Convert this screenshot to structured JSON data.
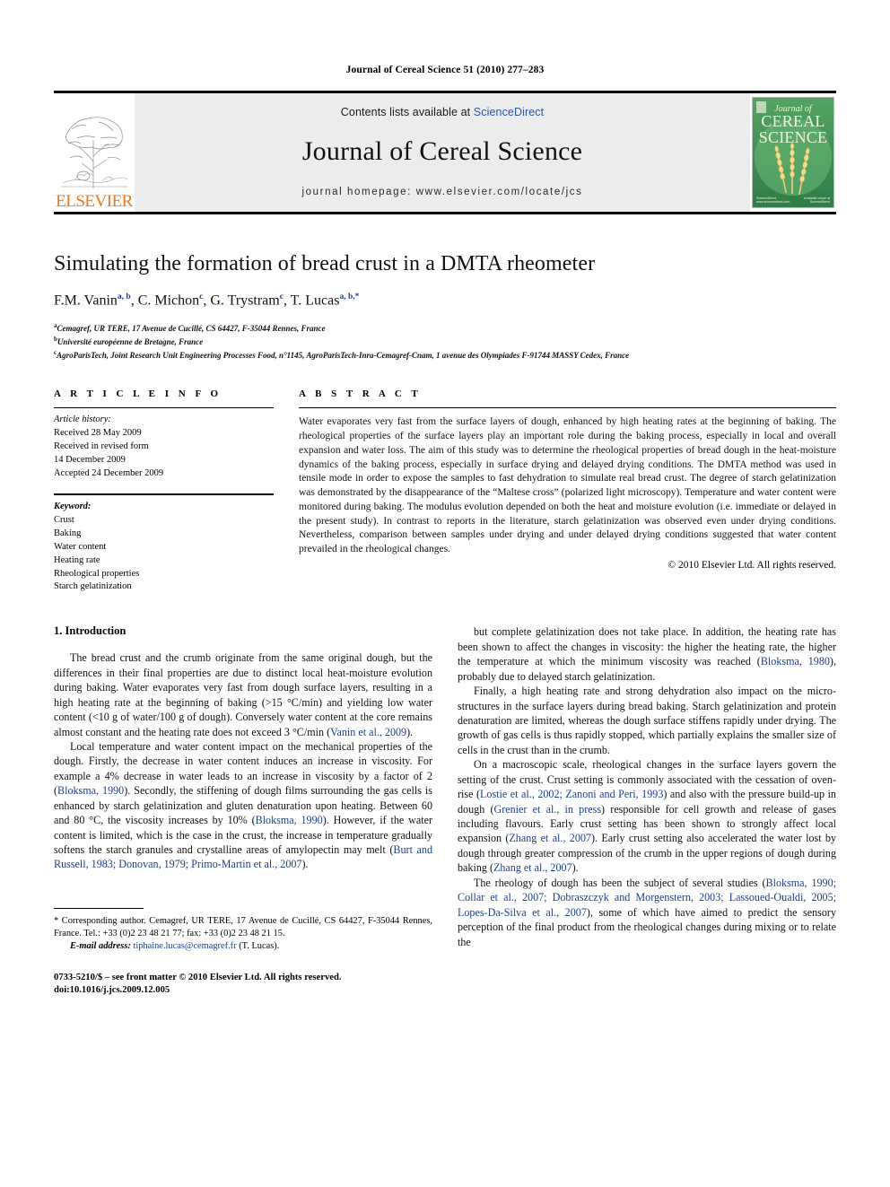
{
  "running_head": "Journal of Cereal Science 51 (2010) 277–283",
  "masthead": {
    "publisher_name": "ELSEVIER",
    "contents_prefix": "Contents lists available at ",
    "contents_link": "ScienceDirect",
    "journal_name": "Journal of Cereal Science",
    "homepage": "journal homepage: www.elsevier.com/locate/jcs",
    "cover": {
      "line1": "Journal of",
      "line2": "CEREAL",
      "line3": "SCIENCE",
      "foot_left": "ScienceDirect\nwww.sciencedirect.com",
      "foot_right": "Available online at\nScienceDirect"
    },
    "link_color": "#2b55a8",
    "band_color": "#ececec",
    "elsevier_orange": "#E87722"
  },
  "article": {
    "title": "Simulating the formation of bread crust in a DMTA rheometer",
    "authors": [
      {
        "name": "F.M. Vanin",
        "sup": "a, b"
      },
      {
        "name": "C. Michon",
        "sup": "c"
      },
      {
        "name": "G. Trystram",
        "sup": "c"
      },
      {
        "name": "T. Lucas",
        "sup": "a, b,*"
      }
    ],
    "affiliations": [
      {
        "mark": "a",
        "text": "Cemagref, UR TERE, 17 Avenue de Cucillé, CS 64427, F-35044 Rennes, France"
      },
      {
        "mark": "b",
        "text": "Université européenne de Bretagne, France"
      },
      {
        "mark": "c",
        "text": "AgroParisTech, Joint Research Unit Engineering Processes Food, n°1145, AgroParisTech-Inra-Cemagref-Cnam, 1 avenue des Olympiades F-91744 MASSY Cedex, France"
      }
    ]
  },
  "article_info": {
    "heading": "A R T I C L E   I N F O",
    "history_label": "Article history:",
    "history_lines": [
      "Received 28 May 2009",
      "Received in revised form",
      "14 December 2009",
      "Accepted 24 December 2009"
    ],
    "keywords_label": "Keyword:",
    "keywords": [
      "Crust",
      "Baking",
      "Water content",
      "Heating rate",
      "Rheological properties",
      "Starch gelatinization"
    ]
  },
  "abstract": {
    "heading": "A B S T R A C T",
    "text": "Water evaporates very fast from the surface layers of dough, enhanced by high heating rates at the beginning of baking. The rheological properties of the surface layers play an important role during the baking process, especially in local and overall expansion and water loss. The aim of this study was to determine the rheological properties of bread dough in the heat-moisture dynamics of the baking process, especially in surface drying and delayed drying conditions. The DMTA method was used in tensile mode in order to expose the samples to fast dehydration to simulate real bread crust. The degree of starch gelatinization was demonstrated by the disappearance of the “Maltese cross” (polarized light microscopy). Temperature and water content were monitored during baking. The modulus evolution depended on both the heat and moisture evolution (i.e. immediate or delayed in the present study). In contrast to reports in the literature, starch gelatinization was observed even under drying conditions. Nevertheless, comparison between samples under drying and under delayed drying conditions suggested that water content prevailed in the rheological changes.",
    "copyright": "© 2010 Elsevier Ltd. All rights reserved."
  },
  "body": {
    "section_number_title": "1. Introduction",
    "left_paragraphs": [
      {
        "segments": [
          {
            "t": "The bread crust and the crumb originate from the same original dough, but the differences in their final properties are due to distinct local heat-moisture evolution during baking. Water evaporates very fast from dough surface layers, resulting in a high heating rate at the beginning of baking (>15 °C/min) and yielding low water content (<10 g of water/100 g of dough). Conversely water content at the core remains almost constant and the heating rate does not exceed 3 °C/min (",
            "ref": false
          },
          {
            "t": "Vanin et al., 2009",
            "ref": true
          },
          {
            "t": ").",
            "ref": false
          }
        ]
      },
      {
        "segments": [
          {
            "t": "Local temperature and water content impact on the mechanical properties of the dough. Firstly, the decrease in water content induces an increase in viscosity. For example a 4% decrease in water leads to an increase in viscosity by a factor of 2 (",
            "ref": false
          },
          {
            "t": "Bloksma, 1990",
            "ref": true
          },
          {
            "t": "). Secondly, the stiffening of dough films surrounding the gas cells is enhanced by starch gelatinization and gluten denaturation upon heating. Between 60 and 80 °C, the viscosity increases by 10% (",
            "ref": false
          },
          {
            "t": "Bloksma, 1990",
            "ref": true
          },
          {
            "t": "). However, if the water content is limited, which is the case in the crust, the increase in temperature gradually softens the starch granules and crystalline areas of amylopectin may melt (",
            "ref": false
          },
          {
            "t": "Burt and Russell, 1983; Donovan, 1979; Primo-Martin et al., 2007",
            "ref": true
          },
          {
            "t": ").",
            "ref": false
          }
        ]
      }
    ],
    "right_paragraphs": [
      {
        "segments": [
          {
            "t": "but complete gelatinization does not take place. In addition, the heating rate has been shown to affect the changes in viscosity: the higher the heating rate, the higher the temperature at which the minimum viscosity was reached (",
            "ref": false
          },
          {
            "t": "Bloksma, 1980",
            "ref": true
          },
          {
            "t": "), probably due to delayed starch gelatinization.",
            "ref": false
          }
        ]
      },
      {
        "segments": [
          {
            "t": "Finally, a high heating rate and strong dehydration also impact on the micro-structures in the surface layers during bread baking. Starch gelatinization and protein denaturation are limited, whereas the dough surface stiffens rapidly under drying. The growth of gas cells is thus rapidly stopped, which partially explains the smaller size of cells in the crust than in the crumb.",
            "ref": false
          }
        ]
      },
      {
        "segments": [
          {
            "t": "On a macroscopic scale, rheological changes in the surface layers govern the setting of the crust. Crust setting is commonly associated with the cessation of oven-rise (",
            "ref": false
          },
          {
            "t": "Lostie et al., 2002; Zanoni and Peri, 1993",
            "ref": true
          },
          {
            "t": ") and also with the pressure build-up in dough (",
            "ref": false
          },
          {
            "t": "Grenier et al., in press",
            "ref": true
          },
          {
            "t": ") responsible for cell growth and release of gases including flavours. Early crust setting has been shown to strongly affect local expansion (",
            "ref": false
          },
          {
            "t": "Zhang et al., 2007",
            "ref": true
          },
          {
            "t": "). Early crust setting also accelerated the water lost by dough through greater compression of the crumb in the upper regions of dough during baking (",
            "ref": false
          },
          {
            "t": "Zhang et al., 2007",
            "ref": true
          },
          {
            "t": ").",
            "ref": false
          }
        ]
      },
      {
        "segments": [
          {
            "t": "The rheology of dough has been the subject of several studies (",
            "ref": false
          },
          {
            "t": "Bloksma, 1990; Collar et al., 2007; Dobraszczyk and Morgenstern, 2003; Lassoued-Oualdi, 2005; Lopes-Da-Silva et al., 2007",
            "ref": true
          },
          {
            "t": "), some of which have aimed to predict the sensory perception of the final product from the rheological changes during mixing or to relate the",
            "ref": false
          }
        ]
      }
    ]
  },
  "footnote": {
    "corresponding": "* Corresponding author. Cemagref, UR TERE, 17 Avenue de Cucillé, CS 64427, F-35044 Rennes, France. Tel.: +33 (0)2 23 48 21 77; fax: +33 (0)2 23 48 21 15.",
    "email_label": "E-mail address:",
    "email": "tiphaine.lucas@cemagref.fr",
    "email_suffix": "(T. Lucas)."
  },
  "imprint": {
    "line1": "0733-5210/$ – see front matter © 2010 Elsevier Ltd. All rights reserved.",
    "line2": "doi:10.1016/j.jcs.2009.12.005"
  }
}
